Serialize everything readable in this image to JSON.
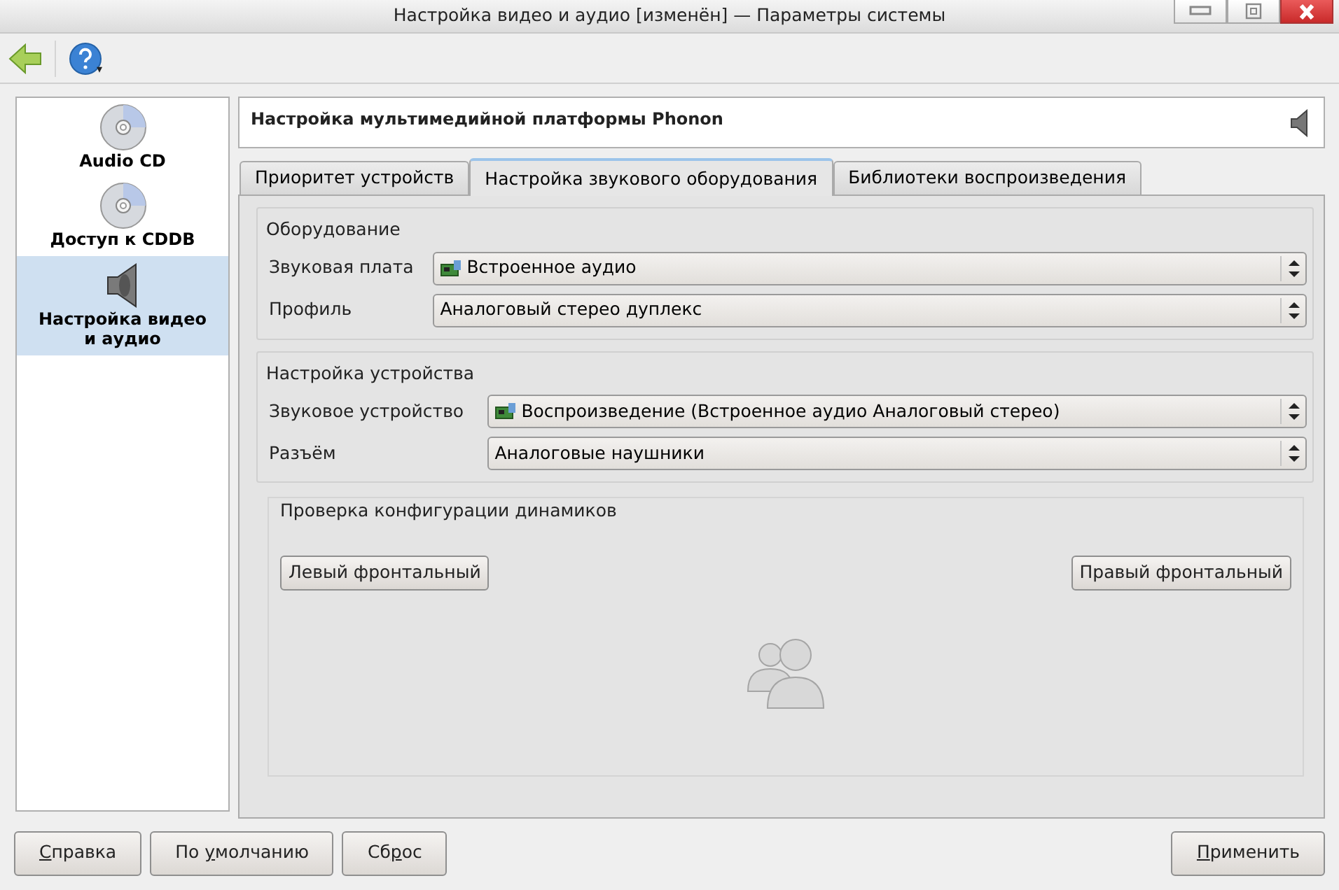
{
  "window": {
    "title": "Настройка видео и аудио [изменён] — Параметры системы"
  },
  "toolbar": {
    "help_menu": "▾"
  },
  "sidebar": {
    "items": [
      {
        "label": "Audio CD",
        "kind": "disc",
        "selected": false
      },
      {
        "label": "Доступ к CDDB",
        "kind": "disc",
        "selected": false
      },
      {
        "label": "Настройка видео и аудио",
        "kind": "speaker",
        "selected": true
      }
    ]
  },
  "header": {
    "title": "Настройка мультимедийной платформы Phonon"
  },
  "tabs": [
    {
      "label": "Приоритет устройств",
      "selected": false
    },
    {
      "label": "Настройка звукового оборудования",
      "selected": true
    },
    {
      "label": "Библиотеки воспроизведения",
      "selected": false
    }
  ],
  "groups": [
    {
      "title": "Оборудование",
      "fields": [
        {
          "label": "Звуковая плата",
          "value": "Встроенное аудио",
          "kind": "card"
        },
        {
          "label": "Профиль",
          "value": "Аналоговый стерео дуплекс",
          "kind": "plain"
        }
      ]
    },
    {
      "title": "Настройка устройства",
      "fields": [
        {
          "label": "Звуковое устройство",
          "value": "Воспроизведение (Встроенное аудио Аналоговый стерео)",
          "kind": "card"
        },
        {
          "label": "Разъём",
          "value": "Аналоговые наушники",
          "kind": "plain"
        }
      ]
    }
  ],
  "speaker_test": {
    "title": "Проверка конфигурации динамиков",
    "buttons": [
      "Левый фронтальный",
      "Правый фронтальный"
    ]
  },
  "footer": {
    "left_buttons": [
      {
        "mnemonic": "С",
        "after": "правка"
      },
      {
        "before": "По ",
        "mnemonic": "у",
        "after": "молчанию"
      },
      {
        "before": "Сб",
        "mnemonic": "р",
        "after": "ос"
      }
    ],
    "right_buttons": [
      {
        "mnemonic": "П",
        "after": "рименить"
      }
    ]
  }
}
